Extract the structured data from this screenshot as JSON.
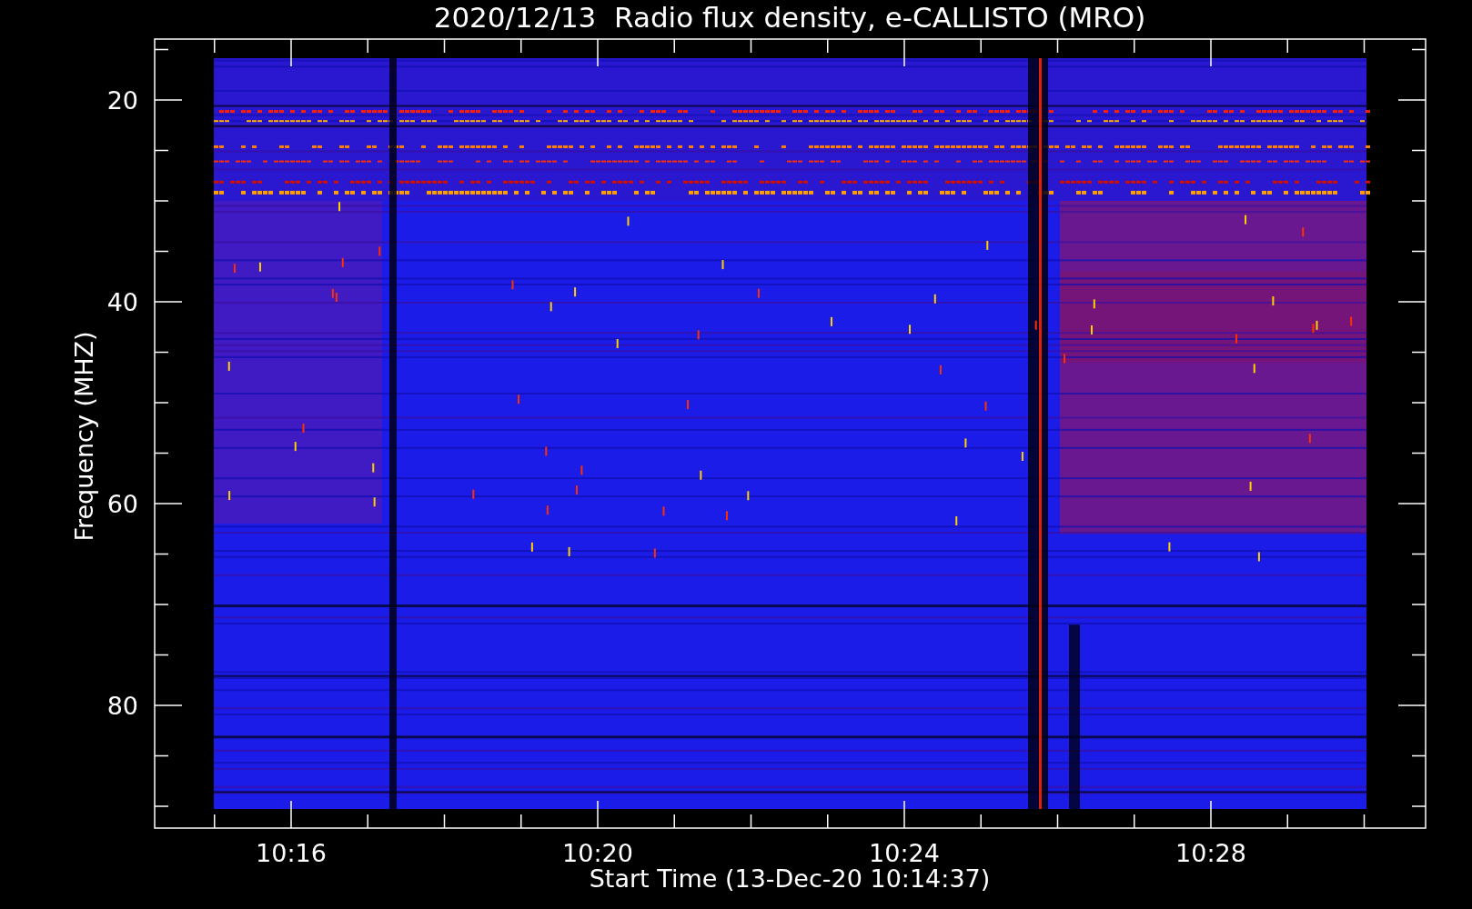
{
  "plot": {
    "title": "2020/12/13  Radio flux density, e-CALLISTO (MRO)",
    "ylabel": "Frequency (MHZ)",
    "xlabel": "Start Time (13-Dec-20 10:14:37)",
    "yticks": [
      "20",
      "40",
      "60",
      "80"
    ],
    "xticks": [
      "10:16",
      "10:20",
      "10:24",
      "10:28"
    ]
  }
}
